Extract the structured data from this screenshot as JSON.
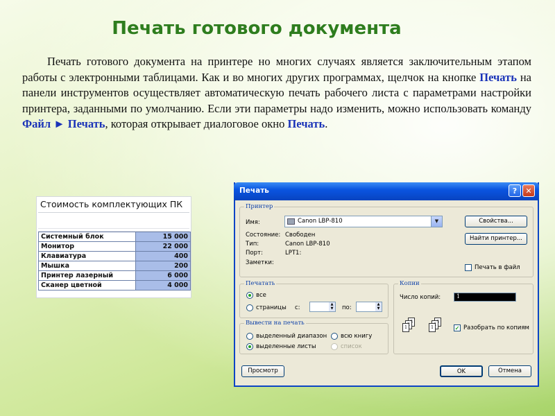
{
  "title": "Печать готового документа",
  "paragraph": {
    "part1": "Печать готового документа на принтере но многих случаях является заключительным этапом работы с электронными таблицами. Как и во многих других программах, щелчок на кнопке ",
    "kw1": "Печать",
    "part2": " на панели инструментов осуществляет автоматическую печать рабочего листа с параметрами настройки принтера, заданными по умолчанию. Если эти параметры надо изменить, можно использовать команду ",
    "kw2": "Файл ► Печать",
    "part3": ", которая открывает диалоговое окно ",
    "kw3": "Печать",
    "part4": "."
  },
  "sheet": {
    "title": "Стоимость комплектующих ПК",
    "rows": [
      {
        "label": "Системный блок",
        "value": "15 000"
      },
      {
        "label": "Монитор",
        "value": "22 000"
      },
      {
        "label": "Клавиатура",
        "value": "400"
      },
      {
        "label": "Мышка",
        "value": "200"
      },
      {
        "label": "Принтер лазерный",
        "value": "6 000"
      },
      {
        "label": "Сканер цветной",
        "value": "4 000"
      }
    ]
  },
  "dialog": {
    "title": "Печать",
    "help": "?",
    "close": "✕",
    "printer": {
      "group": "Принтер",
      "name_label": "Имя:",
      "name_value": "Canon LBP-810",
      "status_label": "Состояние:",
      "status_value": "Свободен",
      "type_label": "Тип:",
      "type_value": "Canon LBP-810",
      "port_label": "Порт:",
      "port_value": "LPT1:",
      "notes_label": "Заметки:",
      "properties_button": "Свойства...",
      "find_button": "Найти принтер...",
      "print_to_file": "Печать в файл"
    },
    "range": {
      "group": "Печатать",
      "all": "все",
      "pages": "страницы",
      "from": "с:",
      "to": "по:"
    },
    "copies": {
      "group": "Копии",
      "count_label": "Число копий:",
      "count_value": "1",
      "collate": "Разобрать по копиям"
    },
    "output": {
      "group": "Вывести на печать",
      "selection": "выделенный диапазон",
      "workbook": "всю книгу",
      "sheets": "выделенные листы",
      "list": "список"
    },
    "preview_button": "Просмотр",
    "ok_button": "OK",
    "cancel_button": "Отмена"
  },
  "colors": {
    "title": "#2e7d1e",
    "keyword": "#1a33b8",
    "titlebar": "#0a55e0"
  }
}
